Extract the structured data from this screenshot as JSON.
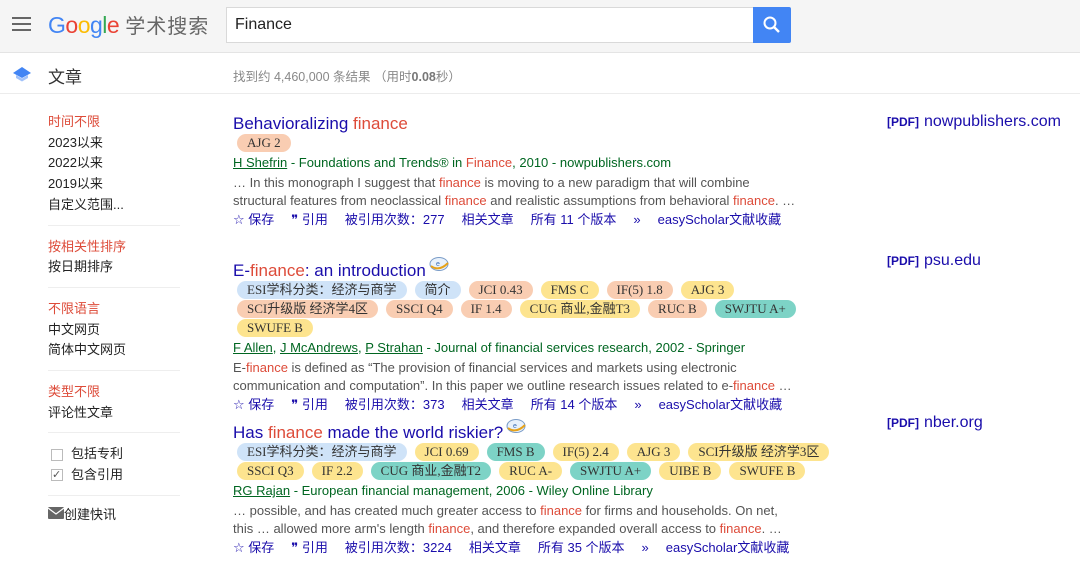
{
  "header": {
    "logo_google": "Google",
    "logo_suffix": "学术搜索",
    "search_value": "Finance"
  },
  "subbar": {
    "section": "文章",
    "stats_prefix": "找到约 4,460,000 条结果 （用时",
    "stats_time": "0.08",
    "stats_suffix": "秒）"
  },
  "sidebar": {
    "groups": [
      {
        "items": [
          {
            "label": "时间不限",
            "selected": true
          },
          {
            "label": "2023以来"
          },
          {
            "label": "2022以来"
          },
          {
            "label": "2019以来"
          },
          {
            "label": "自定义范围..."
          }
        ]
      },
      {
        "items": [
          {
            "label": "按相关性排序",
            "selected": true
          },
          {
            "label": "按日期排序"
          }
        ]
      },
      {
        "items": [
          {
            "label": "不限语言",
            "selected": true
          },
          {
            "label": "中文网页"
          },
          {
            "label": "简体中文网页"
          }
        ]
      },
      {
        "items": [
          {
            "label": "类型不限",
            "selected": true
          },
          {
            "label": "评论性文章"
          }
        ]
      }
    ],
    "checkboxes": [
      {
        "label": "包括专利",
        "checked": false
      },
      {
        "label": "包含引用",
        "checked": true
      }
    ],
    "alert": "创建快讯"
  },
  "colors": {
    "blue": "#cfe3f8",
    "orange": "#f9cdb2",
    "yellow": "#fde48f",
    "teal": "#7dd3c6",
    "highlight": "#dd4b39",
    "link": "#1a0dab"
  },
  "results": [
    {
      "title": [
        {
          "t": "Behavioralizing "
        },
        {
          "t": "finance",
          "hl": true
        }
      ],
      "has_icon": false,
      "tags": [
        {
          "t": "AJG 2",
          "c": "orange"
        }
      ],
      "authors": [
        "H Shefrin"
      ],
      "source": [
        {
          "t": " - Foundations and Trends® in "
        },
        {
          "t": "Finance",
          "hl": true
        },
        {
          "t": ", 2010 - nowpublishers.com"
        }
      ],
      "snippet": [
        [
          {
            "t": "… In this monograph I suggest that "
          },
          {
            "t": "finance",
            "hl": true
          },
          {
            "t": " is moving to a new paradigm that will combine"
          }
        ],
        [
          {
            "t": "structural features from neoclassical "
          },
          {
            "t": "finance",
            "hl": true
          },
          {
            "t": " and realistic assumptions from behavioral "
          },
          {
            "t": "finance",
            "hl": true
          },
          {
            "t": ". …"
          }
        ]
      ],
      "actions": {
        "save": "保存",
        "cite": "引用",
        "cited": "被引用次数：277",
        "related": "相关文章",
        "versions": "所有 11 个版本",
        "easy": "easyScholar文献收藏"
      },
      "pdf": {
        "tag": "[PDF]",
        "domain": "nowpublishers.com"
      }
    },
    {
      "title": [
        {
          "t": "E-"
        },
        {
          "t": "finance",
          "hl": true
        },
        {
          "t": ": an introduction"
        }
      ],
      "has_icon": true,
      "tags": [
        {
          "t": "ESI学科分类：经济与商学",
          "c": "blue"
        },
        {
          "t": "简介",
          "c": "blue"
        },
        {
          "t": "JCI 0.43",
          "c": "orange"
        },
        {
          "t": "FMS C",
          "c": "yellow"
        },
        {
          "t": "IF(5) 1.8",
          "c": "orange"
        },
        {
          "t": "AJG 3",
          "c": "yellow"
        },
        {
          "t": "SCI升级版 经济学4区",
          "c": "orange"
        },
        {
          "t": "SSCI Q4",
          "c": "orange"
        },
        {
          "t": "IF 1.4",
          "c": "orange"
        },
        {
          "t": "CUG 商业,金融T3",
          "c": "yellow"
        },
        {
          "t": "RUC B",
          "c": "orange"
        },
        {
          "t": "SWJTU A+",
          "c": "teal"
        },
        {
          "t": "SWUFE B",
          "c": "yellow"
        }
      ],
      "authors": [
        "F Allen",
        "J McAndrews",
        "P Strahan"
      ],
      "source": [
        {
          "t": " - Journal of financial services research, 2002 - Springer"
        }
      ],
      "snippet": [
        [
          {
            "t": "E-"
          },
          {
            "t": "finance",
            "hl": true
          },
          {
            "t": " is defined as “The provision of financial services and markets using electronic"
          }
        ],
        [
          {
            "t": "communication and computation”. In this paper we outline research issues related to e-"
          },
          {
            "t": "finance",
            "hl": true
          },
          {
            "t": " …"
          }
        ]
      ],
      "actions": {
        "save": "保存",
        "cite": "引用",
        "cited": "被引用次数：373",
        "related": "相关文章",
        "versions": "所有 14 个版本",
        "easy": "easyScholar文献收藏"
      },
      "pdf": {
        "tag": "[PDF]",
        "domain": "psu.edu"
      }
    },
    {
      "title": [
        {
          "t": "Has "
        },
        {
          "t": "finance",
          "hl": true
        },
        {
          "t": " made the world riskier?"
        }
      ],
      "has_icon": true,
      "tags": [
        {
          "t": "ESI学科分类：经济与商学",
          "c": "blue"
        },
        {
          "t": "JCI 0.69",
          "c": "yellow"
        },
        {
          "t": "FMS B",
          "c": "teal"
        },
        {
          "t": "IF(5) 2.4",
          "c": "yellow"
        },
        {
          "t": "AJG 3",
          "c": "yellow"
        },
        {
          "t": "SCI升级版 经济学3区",
          "c": "yellow"
        },
        {
          "t": "SSCI Q3",
          "c": "yellow"
        },
        {
          "t": "IF 2.2",
          "c": "yellow"
        },
        {
          "t": "CUG 商业,金融T2",
          "c": "teal"
        },
        {
          "t": "RUC A-",
          "c": "yellow"
        },
        {
          "t": "SWJTU A+",
          "c": "teal"
        },
        {
          "t": "UIBE B",
          "c": "yellow"
        },
        {
          "t": "SWUFE B",
          "c": "yellow"
        }
      ],
      "authors": [
        "RG Rajan"
      ],
      "source": [
        {
          "t": " - European financial management, 2006 - Wiley Online Library"
        }
      ],
      "snippet": [
        [
          {
            "t": "… possible, and has created much greater access to "
          },
          {
            "t": "finance",
            "hl": true
          },
          {
            "t": " for firms and households. On net,"
          }
        ],
        [
          {
            "t": "this … allowed more arm's length "
          },
          {
            "t": "finance",
            "hl": true
          },
          {
            "t": ", and therefore expanded overall access to "
          },
          {
            "t": "finance",
            "hl": true
          },
          {
            "t": ". …"
          }
        ]
      ],
      "actions": {
        "save": "保存",
        "cite": "引用",
        "cited": "被引用次数：3224",
        "related": "相关文章",
        "versions": "所有 35 个版本",
        "easy": "easyScholar文献收藏"
      },
      "pdf": {
        "tag": "[PDF]",
        "domain": "nber.org"
      }
    }
  ]
}
